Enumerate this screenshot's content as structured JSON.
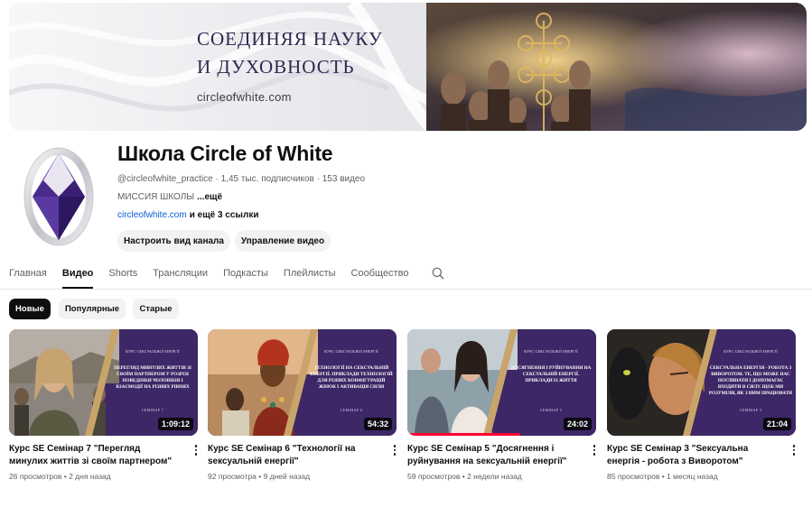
{
  "banner": {
    "title": "СОЕДИНЯЯ НАУКУ\nИ ДУХОВНОСТЬ",
    "url": "circleofwhite.com"
  },
  "channel": {
    "name": "Школа Circle of White",
    "handle": "@circleofwhite_practice",
    "subscribers": "1,45 тыс. подписчиков",
    "videos_count": "153 видео",
    "separator": " · ",
    "description": "МИССИЯ ШКОЛЫ",
    "description_more": "...ещё",
    "link": "circleofwhite.com",
    "links_more": "и ещё 3 ссылки",
    "customize_button": "Настроить вид канала",
    "manage_button": "Управление видео"
  },
  "tabs": [
    "Главная",
    "Видео",
    "Shorts",
    "Трансляции",
    "Подкасты",
    "Плейлисты",
    "Сообщество"
  ],
  "active_tab": "Видео",
  "filters": {
    "new": "Новые",
    "popular": "Популярные",
    "old": "Старые",
    "selected": "Новые"
  },
  "videos": [
    {
      "title": "Курс SE Семінар 7 \"Перегляд минулих життів зі своїм партнером\"",
      "views": "26 просмотров",
      "age": "2 дня назад",
      "duration": "1:09:12",
      "thumb_panel_title": "КУРС СЕКСУАЛЬНОЇ ЕНЕРГІЇ",
      "thumb_panel_text": "Перегляд минулих життів зі своїм партнером у розрізі поведінки чоловіків і взаємодії на різних рівнях",
      "thumb_panel_seminar": "СЕМІНАР 7",
      "watch_progress": 0
    },
    {
      "title": "Курс SE Семінар 6 \"Технології на sексуальній енергії\"",
      "views": "92 просмотра",
      "age": "9 дней назад",
      "duration": "54:32",
      "thumb_panel_title": "КУРС СЕКСУАЛЬНОЇ ЕНЕРГІЇ",
      "thumb_panel_text": "Технології на сексуальній енергії. Приклади технологій для різних конфігурацій жінок і активація сили",
      "thumb_panel_seminar": "СЕМІНАР 6",
      "watch_progress": 0
    },
    {
      "title": "Курс SE Семінар 5 \"Досягнення і руйнування на sексуальній енергії\"",
      "views": "59 просмотров",
      "age": "2 недели назад",
      "duration": "24:02",
      "thumb_panel_title": "КУРС СЕКСУАЛЬНОЇ ЕНЕРГІЇ",
      "thumb_panel_text": "Досягнення і руйнування на сексуальній енергії. Приклади із життя",
      "thumb_panel_seminar": "СЕМІНАР 5",
      "watch_progress": 0.6
    },
    {
      "title": "Курс SE Семінар 3 \"Sексуальна енергія - робота з Виворотом\"",
      "views": "85 просмотров",
      "age": "1 месяц назад",
      "duration": "21:04",
      "thumb_panel_title": "КУРС СЕКСУАЛЬНОЇ ЕНЕРГІЇ",
      "thumb_panel_text": "Сексуальна енергія - робота з виворотом. Те, що може нас поглинати і допомагає входити в силу. Щоб ми розуміли, як з ним працювати",
      "thumb_panel_seminar": "СЕМІНАР 3",
      "watch_progress": 0
    }
  ],
  "colors": {
    "accent_red": "#ff0033",
    "link_blue": "#065fd4",
    "thumb_purple": "#3d2766",
    "banner_text": "#2b2950"
  },
  "icons": {
    "search": "search-icon",
    "more": "more-vert-icon",
    "avatar": "channel-logo-icon"
  }
}
